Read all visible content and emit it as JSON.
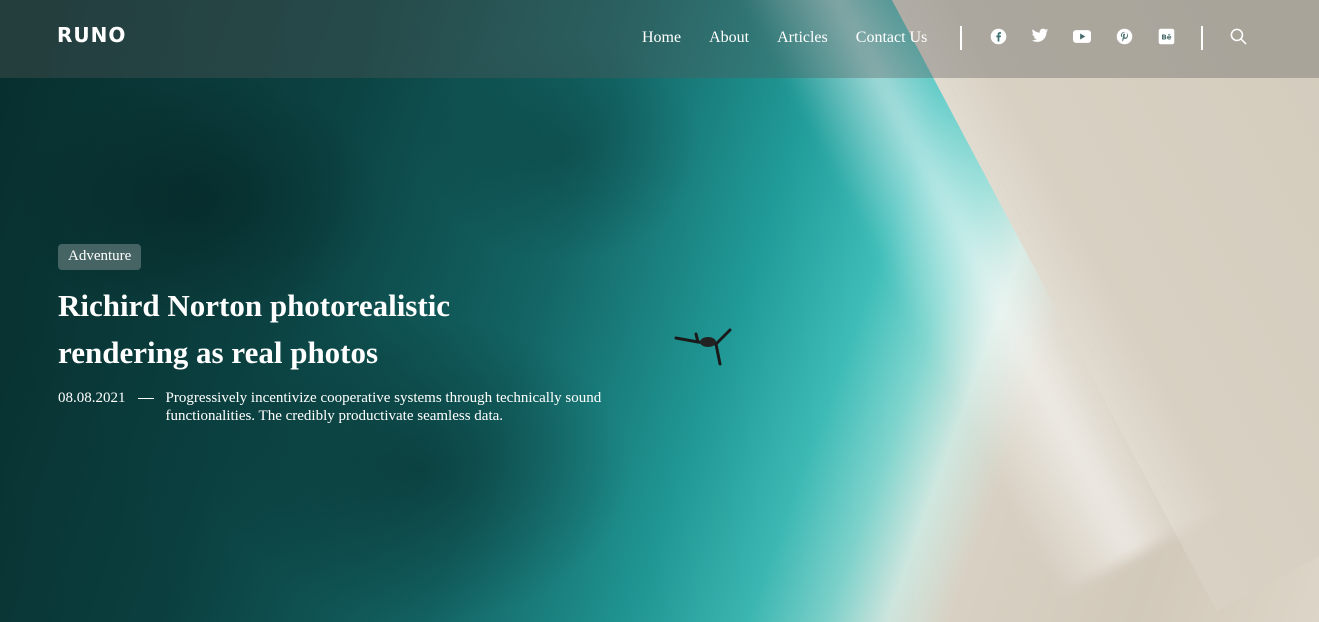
{
  "brand": {
    "logo": "RUNO"
  },
  "nav": {
    "items": [
      {
        "label": "Home"
      },
      {
        "label": "About"
      },
      {
        "label": "Articles"
      },
      {
        "label": "Contact Us"
      }
    ]
  },
  "social": {
    "icons": [
      "facebook-icon",
      "twitter-icon",
      "youtube-icon",
      "pinterest-icon",
      "behance-icon"
    ],
    "behance_text": "Bē"
  },
  "search": {
    "icon": "search-icon"
  },
  "hero": {
    "category": "Adventure",
    "title": "Richird Norton photorealistic rendering as real photos",
    "date": "08.08.2021",
    "excerpt": "Progressively incentivize cooperative systems through technically sound functionalities. The credibly productivate seamless data."
  },
  "colors": {
    "text": "#ffffff",
    "header_overlay": "#5a5a5a",
    "sea": "#167272",
    "sand": "#d9d2c4"
  }
}
